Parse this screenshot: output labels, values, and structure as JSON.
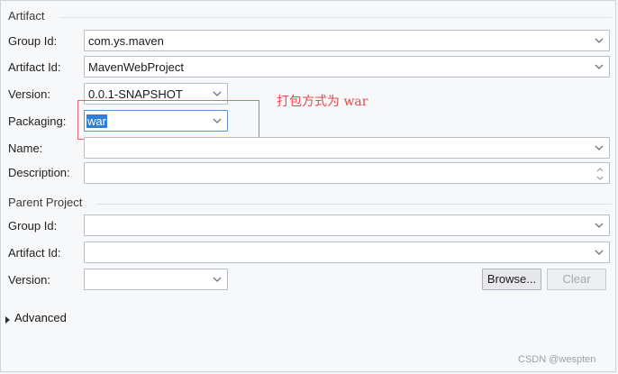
{
  "artifact": {
    "title": "Artifact",
    "group_id_label": "Group Id:",
    "group_id_value": "com.ys.maven",
    "artifact_id_label": "Artifact Id:",
    "artifact_id_value": "MavenWebProject",
    "version_label": "Version:",
    "version_value": "0.0.1-SNAPSHOT",
    "packaging_label": "Packaging:",
    "packaging_value": "war",
    "name_label": "Name:",
    "name_value": "",
    "description_label": "Description:",
    "description_value": ""
  },
  "parent": {
    "title": "Parent Project",
    "group_id_label": "Group Id:",
    "group_id_value": "",
    "artifact_id_label": "Artifact Id:",
    "artifact_id_value": "",
    "version_label": "Version:",
    "version_value": "",
    "browse_label": "Browse...",
    "clear_label": "Clear"
  },
  "advanced": {
    "label": "Advanced"
  },
  "annotation": {
    "text": "打包方式为 war"
  },
  "watermark": {
    "text": "CSDN @wespten"
  },
  "colors": {
    "selection": "#2f7fd6",
    "annotation": "#e24b4b",
    "callout_border": "#e6676c"
  }
}
